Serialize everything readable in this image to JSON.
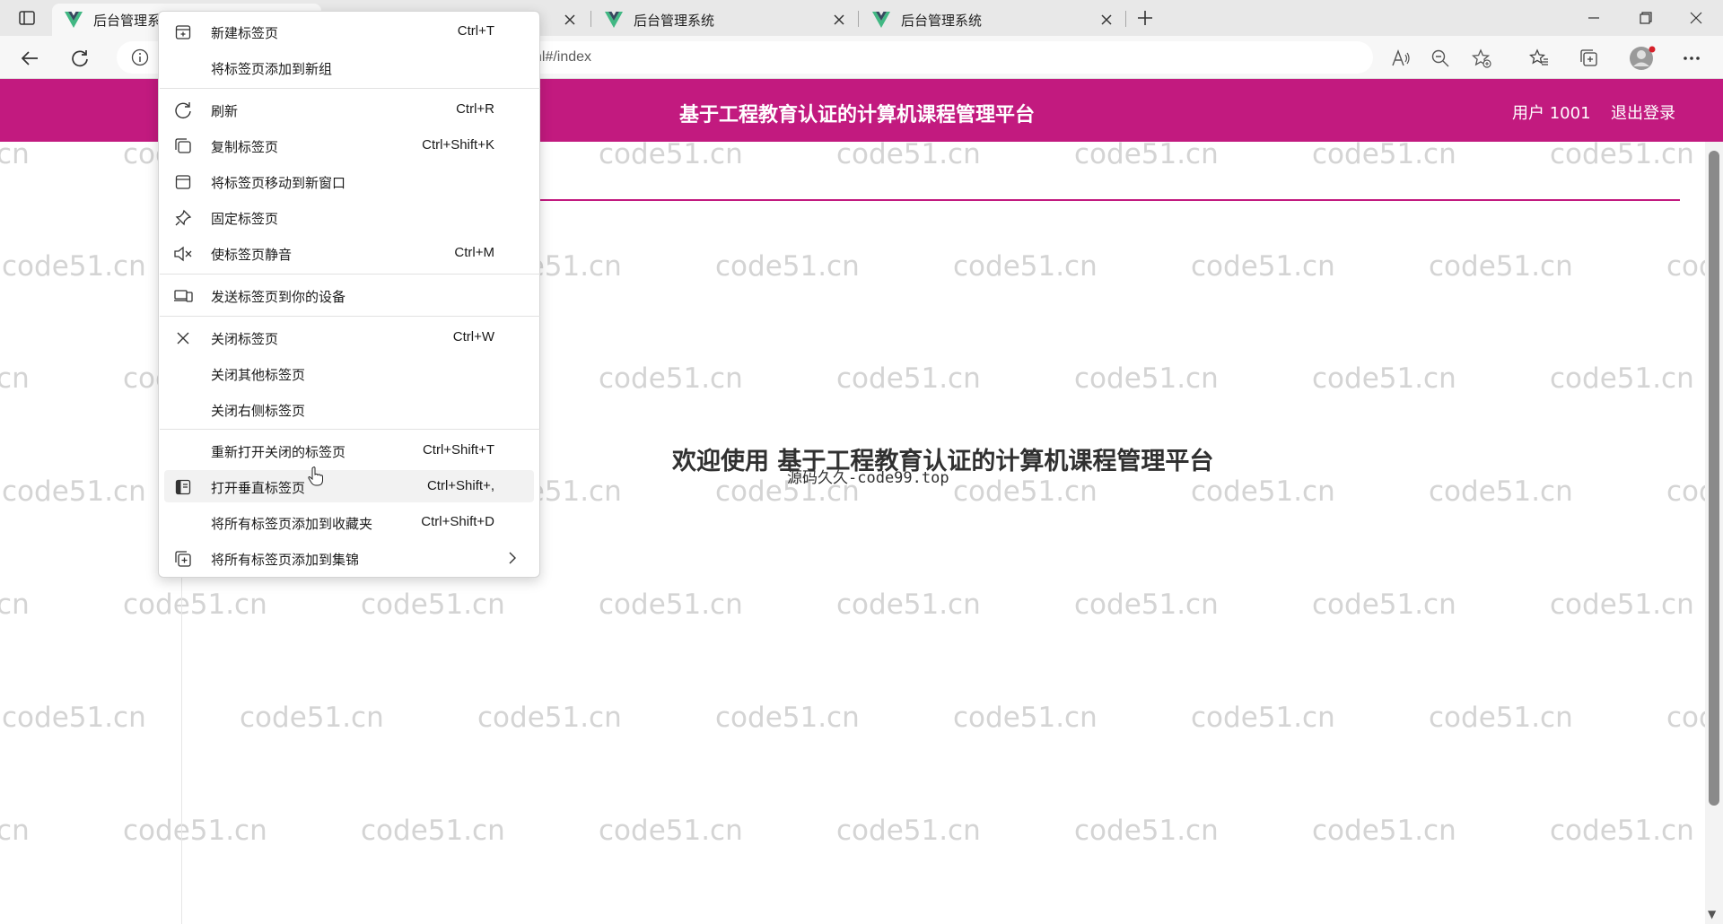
{
  "browser": {
    "tabs": [
      {
        "title": "后台管理系",
        "active": true
      },
      {
        "title": "",
        "active": false
      },
      {
        "title": "后台管理系统",
        "active": false
      },
      {
        "title": "后台管理系统",
        "active": false
      }
    ],
    "address_text": "nl#/index"
  },
  "tab_context_menu": {
    "items": [
      {
        "label": "新建标签页",
        "shortcut": "Ctrl+T",
        "icon": "new-tab-icon"
      },
      {
        "label": "将标签页添加到新组",
        "shortcut": "",
        "icon": ""
      },
      {
        "label": "刷新",
        "shortcut": "Ctrl+R",
        "icon": "refresh-icon"
      },
      {
        "label": "复制标签页",
        "shortcut": "Ctrl+Shift+K",
        "icon": "duplicate-tab-icon"
      },
      {
        "label": "将标签页移动到新窗口",
        "shortcut": "",
        "icon": "new-window-icon"
      },
      {
        "label": "固定标签页",
        "shortcut": "",
        "icon": "pin-icon"
      },
      {
        "label": "使标签页静音",
        "shortcut": "Ctrl+M",
        "icon": "mute-icon"
      },
      {
        "label": "发送标签页到你的设备",
        "shortcut": "",
        "icon": "send-to-device-icon"
      },
      {
        "label": "关闭标签页",
        "shortcut": "Ctrl+W",
        "icon": "close-icon"
      },
      {
        "label": "关闭其他标签页",
        "shortcut": "",
        "icon": ""
      },
      {
        "label": "关闭右侧标签页",
        "shortcut": "",
        "icon": ""
      },
      {
        "label": "重新打开关闭的标签页",
        "shortcut": "Ctrl+Shift+T",
        "icon": ""
      },
      {
        "label": "打开垂直标签页",
        "shortcut": "Ctrl+Shift+,",
        "icon": "vertical-tabs-icon"
      },
      {
        "label": "将所有标签页添加到收藏夹",
        "shortcut": "Ctrl+Shift+D",
        "icon": ""
      },
      {
        "label": "将所有标签页添加到集锦",
        "shortcut": "",
        "icon": "collections-icon"
      }
    ]
  },
  "app": {
    "title": "基于工程教育认证的计算机课程管理平台",
    "user_label": "用户 1001",
    "logout_label": "退出登录",
    "welcome_text": "欢迎使用 基于工程教育认证的计算机课程管理平台",
    "source_note": "源码久久-code99.top",
    "watermark_text": "code51.cn",
    "accent_color": "#c21a7f"
  }
}
